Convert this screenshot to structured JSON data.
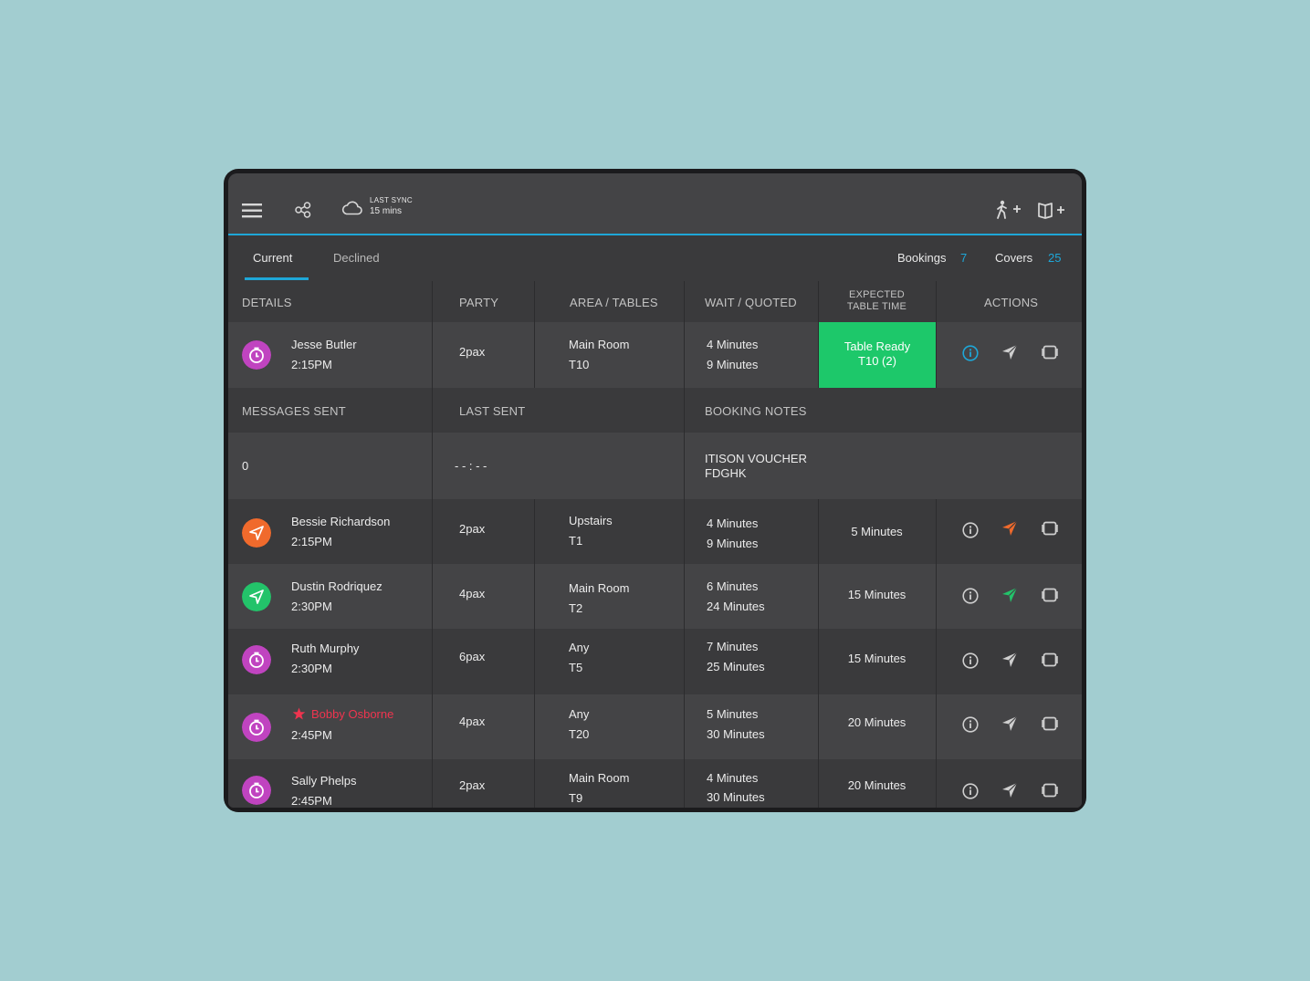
{
  "topbar": {
    "sync_label": "LAST SYNC",
    "sync_value": "15 mins",
    "icons": [
      "menu-icon",
      "share-icon",
      "cloud-icon",
      "walk-in-add-icon",
      "book-add-icon"
    ]
  },
  "tabs": [
    {
      "label": "Current",
      "active": true
    },
    {
      "label": "Declined",
      "active": false
    }
  ],
  "stats": {
    "bookings_label": "Bookings",
    "bookings_value": "7",
    "covers_label": "Covers",
    "covers_value": "25"
  },
  "columns": {
    "details": "DETAILS",
    "party": "PARTY",
    "area": "AREA / TABLES",
    "wait": "WAIT / QUOTED",
    "expected_1": "EXPECTED",
    "expected_2": "TABLE TIME",
    "actions": "ACTIONS"
  },
  "expanded": {
    "messages_label": "MESSAGES  SENT",
    "last_sent_label": "LAST SENT",
    "notes_label": "BOOKING NOTES",
    "messages_value": "0",
    "last_sent_value": "- - : - -",
    "notes_line1": "ITISON VOUCHER",
    "notes_line2": "FDGHK"
  },
  "colors": {
    "accent": "#1ea7d8",
    "ready_green": "#1dc86a",
    "status_purple": "#c044c0",
    "status_orange": "#f06a2c",
    "status_green": "#23c36a",
    "vip_red": "#f0344f"
  },
  "rows": [
    {
      "name": "Jesse Butler",
      "time": "2:15PM",
      "party": "2pax",
      "area": "Main Room",
      "table": "T10",
      "wait": "4 Minutes",
      "quoted": "9 Minutes",
      "expected": "",
      "ready_line1": "Table Ready",
      "ready_line2": "T10 (2)",
      "status": "timer",
      "vip": false,
      "send_state": "default"
    },
    {
      "name": "Bessie Richardson",
      "time": "2:15PM",
      "party": "2pax",
      "area": "Upstairs",
      "table": "T1",
      "wait": "4 Minutes",
      "quoted": "9 Minutes",
      "expected": "5 Minutes",
      "status": "sent-orange",
      "vip": false,
      "send_state": "orange"
    },
    {
      "name": "Dustin Rodriquez",
      "time": "2:30PM",
      "party": "4pax",
      "area": "Main Room",
      "table": "T2",
      "wait": "6 Minutes",
      "quoted": "24 Minutes",
      "expected": "15 Minutes",
      "status": "sent-green",
      "vip": false,
      "send_state": "green"
    },
    {
      "name": "Ruth Murphy",
      "time": "2:30PM",
      "party": "6pax",
      "area": "Any",
      "table": "T5",
      "wait": "7 Minutes",
      "quoted": "25 Minutes",
      "expected": "15 Minutes",
      "status": "timer",
      "vip": false,
      "send_state": "default"
    },
    {
      "name": "Bobby Osborne",
      "time": "2:45PM",
      "party": "4pax",
      "area": "Any",
      "table": "T20",
      "wait": "5 Minutes",
      "quoted": "30 Minutes",
      "expected": "20 Minutes",
      "status": "timer",
      "vip": true,
      "send_state": "default"
    },
    {
      "name": "Sally Phelps",
      "time": "2:45PM",
      "party": "2pax",
      "area": "Main Room",
      "table": "T9",
      "wait": "4 Minutes",
      "quoted": "30 Minutes",
      "expected": "20 Minutes",
      "status": "timer",
      "vip": false,
      "send_state": "default"
    }
  ]
}
